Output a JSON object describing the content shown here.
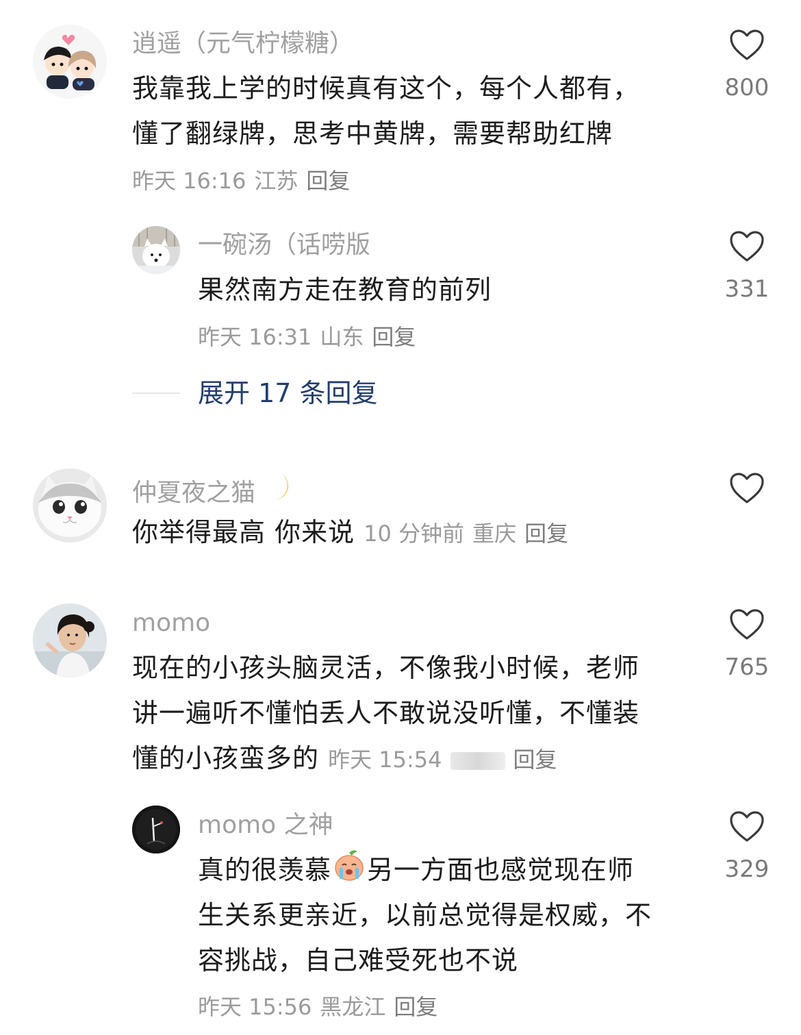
{
  "comments": [
    {
      "username": "逍遥（元气柠檬糖）",
      "content_lines": [
        "我靠我上学的时候真有这个，每个人都有，",
        "懂了翻绿牌，思考中黄牌，需要帮助红牌"
      ],
      "time": "昨天 16:16",
      "location": "江苏",
      "reply_label": "回复",
      "likes": "800",
      "avatar_icon": "couple-cartoon-avatar",
      "replies": [
        {
          "username": "一碗汤（话唠版",
          "content_lines": [
            "果然南方走在教育的前列"
          ],
          "time": "昨天 16:31",
          "location": "山东",
          "reply_label": "回复",
          "likes": "331",
          "avatar_icon": "white-dog-avatar"
        }
      ],
      "expand_label": "展开 17 条回复"
    },
    {
      "username": "仲夏夜之猫",
      "username_emoji": "🌙",
      "content_lines": [
        "你举得最高 你来说"
      ],
      "time": "10 分钟前",
      "location": "重庆",
      "reply_label": "回复",
      "likes": "",
      "avatar_icon": "white-cat-avatar"
    },
    {
      "username": "momo",
      "content_lines": [
        "现在的小孩头脑灵活，不像我小时候，老师",
        "讲一遍听不懂怕丢人不敢说没听懂，不懂装",
        "懂的小孩蛮多的"
      ],
      "time": "昨天 15:54",
      "location": "",
      "reply_label": "回复",
      "likes": "765",
      "avatar_icon": "girl-photo-avatar",
      "replies": [
        {
          "username": "momo 之神",
          "content_lines": [
            "真的很羡慕",
            "另一方面也感觉现在师",
            "生关系更亲近，以前总觉得是权威，不",
            "容挑战，自己难受死也不说"
          ],
          "time": "昨天 15:56",
          "location": "黑龙江",
          "reply_label": "回复",
          "likes": "329",
          "avatar_icon": "dark-sketch-avatar"
        }
      ]
    }
  ],
  "colors": {
    "username": "#a0a0a0",
    "content": "#1c1c1c",
    "meta": "#9a9a9a",
    "expand": "#223d6e",
    "heart": "#3a3a3a"
  }
}
